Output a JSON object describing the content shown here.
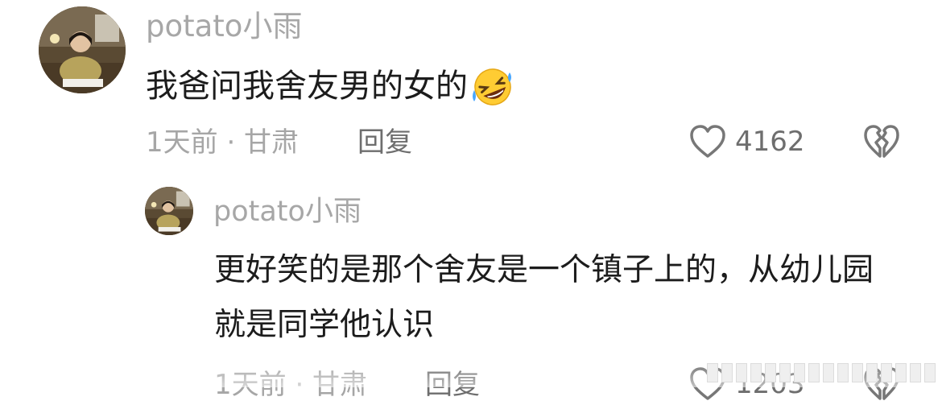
{
  "comment": {
    "username": "potato小雨",
    "text": "我爸问我舍友男的女的",
    "emoji": "rolling-on-floor-laughing-emoji",
    "time_location": "1天前 · 甘肃",
    "reply_label": "回复",
    "like_count": "4162"
  },
  "reply": {
    "username": "potato小雨",
    "text": "更好笑的是那个舍友是一个镇子上的，从幼儿园就是同学他认识",
    "time_location": "1天前 · 甘肃",
    "reply_label": "回复",
    "like_count": "1203"
  },
  "icons": {
    "like": "heart-outline-icon",
    "dislike": "broken-heart-icon"
  },
  "colors": {
    "background": "#ffffff",
    "username": "#a7a7a7",
    "text": "#1c1c1c",
    "meta": "#a6a6a6",
    "action": "#6e6e6e"
  }
}
